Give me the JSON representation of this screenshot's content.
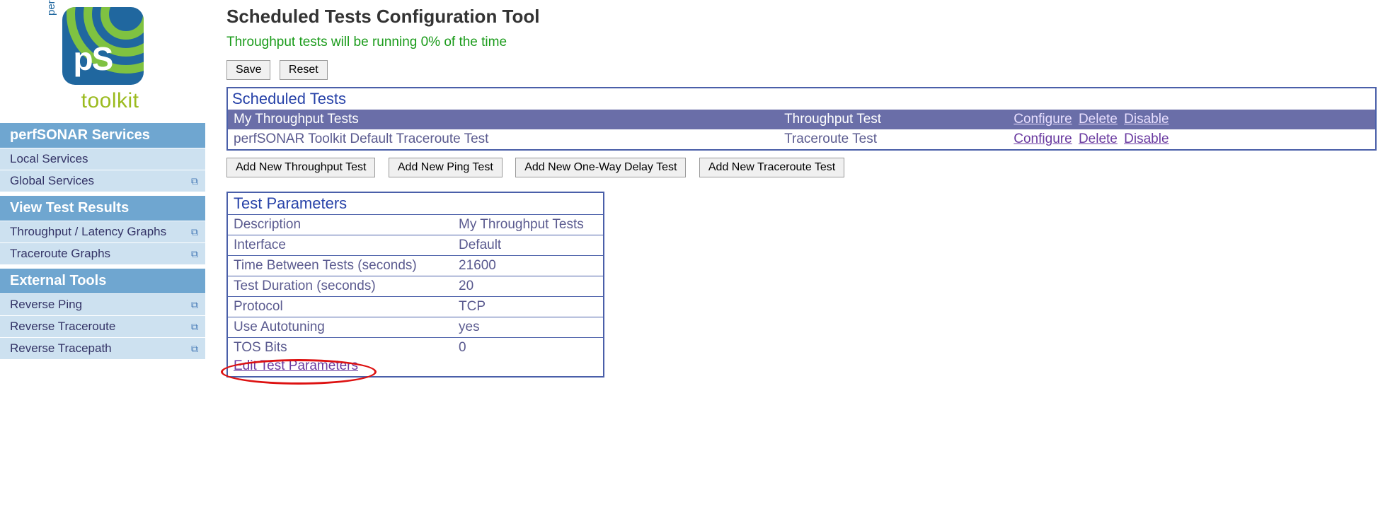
{
  "logo": {
    "perf": "performance",
    "ps": "pS",
    "toolkit": "toolkit"
  },
  "sidebar": {
    "sections": [
      {
        "header": "perfSONAR Services",
        "items": [
          {
            "label": "Local Services",
            "ext": false
          },
          {
            "label": "Global Services",
            "ext": true
          }
        ]
      },
      {
        "header": "View Test Results",
        "items": [
          {
            "label": "Throughput / Latency Graphs",
            "ext": true
          },
          {
            "label": "Traceroute Graphs",
            "ext": true
          }
        ]
      },
      {
        "header": "External Tools",
        "items": [
          {
            "label": "Reverse Ping",
            "ext": true
          },
          {
            "label": "Reverse Traceroute",
            "ext": true
          },
          {
            "label": "Reverse Tracepath",
            "ext": true
          }
        ]
      }
    ]
  },
  "page_title": "Scheduled Tests Configuration Tool",
  "status_line": "Throughput tests will be running 0% of the time",
  "buttons": {
    "save": "Save",
    "reset": "Reset"
  },
  "sched": {
    "title": "Scheduled Tests",
    "rows": [
      {
        "name": "My Throughput Tests",
        "type": "Throughput Test",
        "actions": {
          "configure": "Configure",
          "del": "Delete",
          "disable": "Disable"
        },
        "selected": true
      },
      {
        "name": "perfSONAR Toolkit Default Traceroute Test",
        "type": "Traceroute Test",
        "actions": {
          "configure": "Configure",
          "del": "Delete",
          "disable": "Disable"
        },
        "selected": false
      }
    ]
  },
  "add_buttons": {
    "throughput": "Add New Throughput Test",
    "ping": "Add New Ping Test",
    "owd": "Add New One-Way Delay Test",
    "traceroute": "Add New Traceroute Test"
  },
  "params": {
    "title": "Test Parameters",
    "rows": [
      {
        "label": "Description",
        "value": "My Throughput Tests"
      },
      {
        "label": "Interface",
        "value": "Default"
      },
      {
        "label": "Time Between Tests (seconds)",
        "value": "21600"
      },
      {
        "label": "Test Duration (seconds)",
        "value": "20"
      },
      {
        "label": "Protocol",
        "value": "TCP"
      },
      {
        "label": "Use Autotuning",
        "value": "yes"
      },
      {
        "label": "TOS Bits",
        "value": "0"
      }
    ],
    "edit_link": "Edit Test Parameters"
  }
}
